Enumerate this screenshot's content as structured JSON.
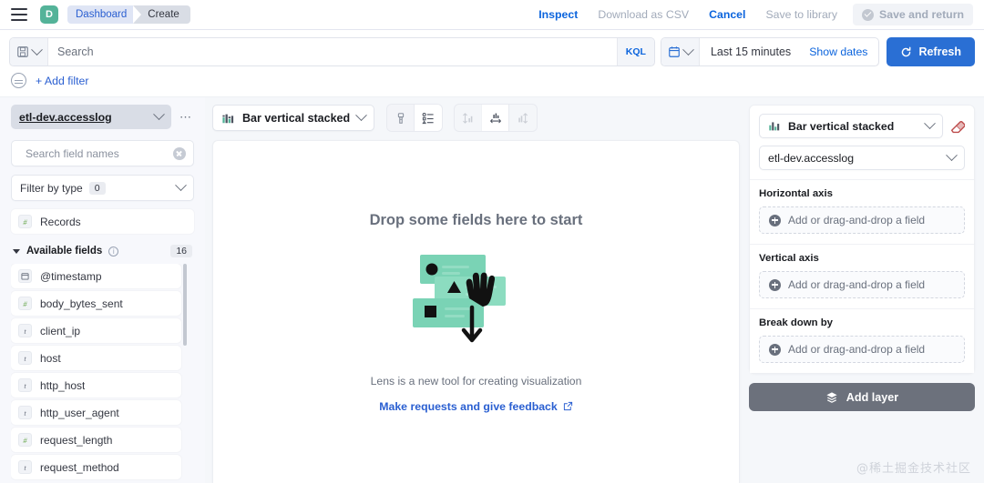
{
  "header": {
    "logo_letter": "D",
    "breadcrumbs": [
      {
        "label": "Dashboard"
      },
      {
        "label": "Create"
      }
    ],
    "actions": [
      {
        "label": "Inspect"
      },
      {
        "label": "Download as CSV"
      },
      {
        "label": "Cancel"
      },
      {
        "label": "Save to library"
      },
      {
        "label": "Save and return"
      }
    ]
  },
  "query_bar": {
    "search_placeholder": "Search",
    "search_value": "",
    "language_badge": "KQL",
    "date_range": "Last 15 minutes",
    "show_dates": "Show dates",
    "refresh_label": "Refresh"
  },
  "filter_bar": {
    "add_filter_label": "+ Add filter"
  },
  "sidebar": {
    "data_source": "etl-dev.accesslog",
    "search_fields_placeholder": "Search field names",
    "search_fields_value": "",
    "filter_by_type_label": "Filter by type",
    "filter_by_type_count": "0",
    "records_field": {
      "label": "Records",
      "type": "number"
    },
    "available_fields_label": "Available fields",
    "available_fields_count": "16",
    "fields": [
      {
        "label": "@timestamp",
        "type": "date"
      },
      {
        "label": "body_bytes_sent",
        "type": "number"
      },
      {
        "label": "client_ip",
        "type": "string"
      },
      {
        "label": "host",
        "type": "string"
      },
      {
        "label": "http_host",
        "type": "string"
      },
      {
        "label": "http_user_agent",
        "type": "string"
      },
      {
        "label": "request_length",
        "type": "number"
      },
      {
        "label": "request_method",
        "type": "string"
      }
    ]
  },
  "chart_toolbar": {
    "chart_type": "Bar vertical stacked",
    "tool_buttons": [
      {
        "name": "brush-settings-icon",
        "disabled": false,
        "selected": false
      },
      {
        "name": "legend-list-icon",
        "disabled": false,
        "selected": true
      },
      {
        "name": "axis-vertical-icon",
        "disabled": true,
        "selected": false
      },
      {
        "name": "axis-horizontal-icon",
        "disabled": false,
        "selected": true
      },
      {
        "name": "axis-both-icon",
        "disabled": true,
        "selected": false
      }
    ]
  },
  "canvas": {
    "drop_title": "Drop some fields here to start",
    "subtitle": "Lens is a new tool for creating visualization",
    "feedback_link": "Make requests and give feedback"
  },
  "config_panel": {
    "chart_type": "Bar vertical stacked",
    "data_source": "etl-dev.accesslog",
    "sections": [
      {
        "title": "Horizontal axis",
        "dropzone": "Add or drag-and-drop a field"
      },
      {
        "title": "Vertical axis",
        "dropzone": "Add or drag-and-drop a field"
      },
      {
        "title": "Break down by",
        "dropzone": "Add or drag-and-drop a field"
      }
    ],
    "add_layer_label": "Add layer"
  },
  "watermark": "@稀土掘金技术社区",
  "colors": {
    "accent_blue": "#2a6fd4",
    "link_blue": "#2a5fd1",
    "brand_teal": "#54b399",
    "add_layer_gray": "#6c717c",
    "illustration_teal": "#7ad3b5"
  }
}
